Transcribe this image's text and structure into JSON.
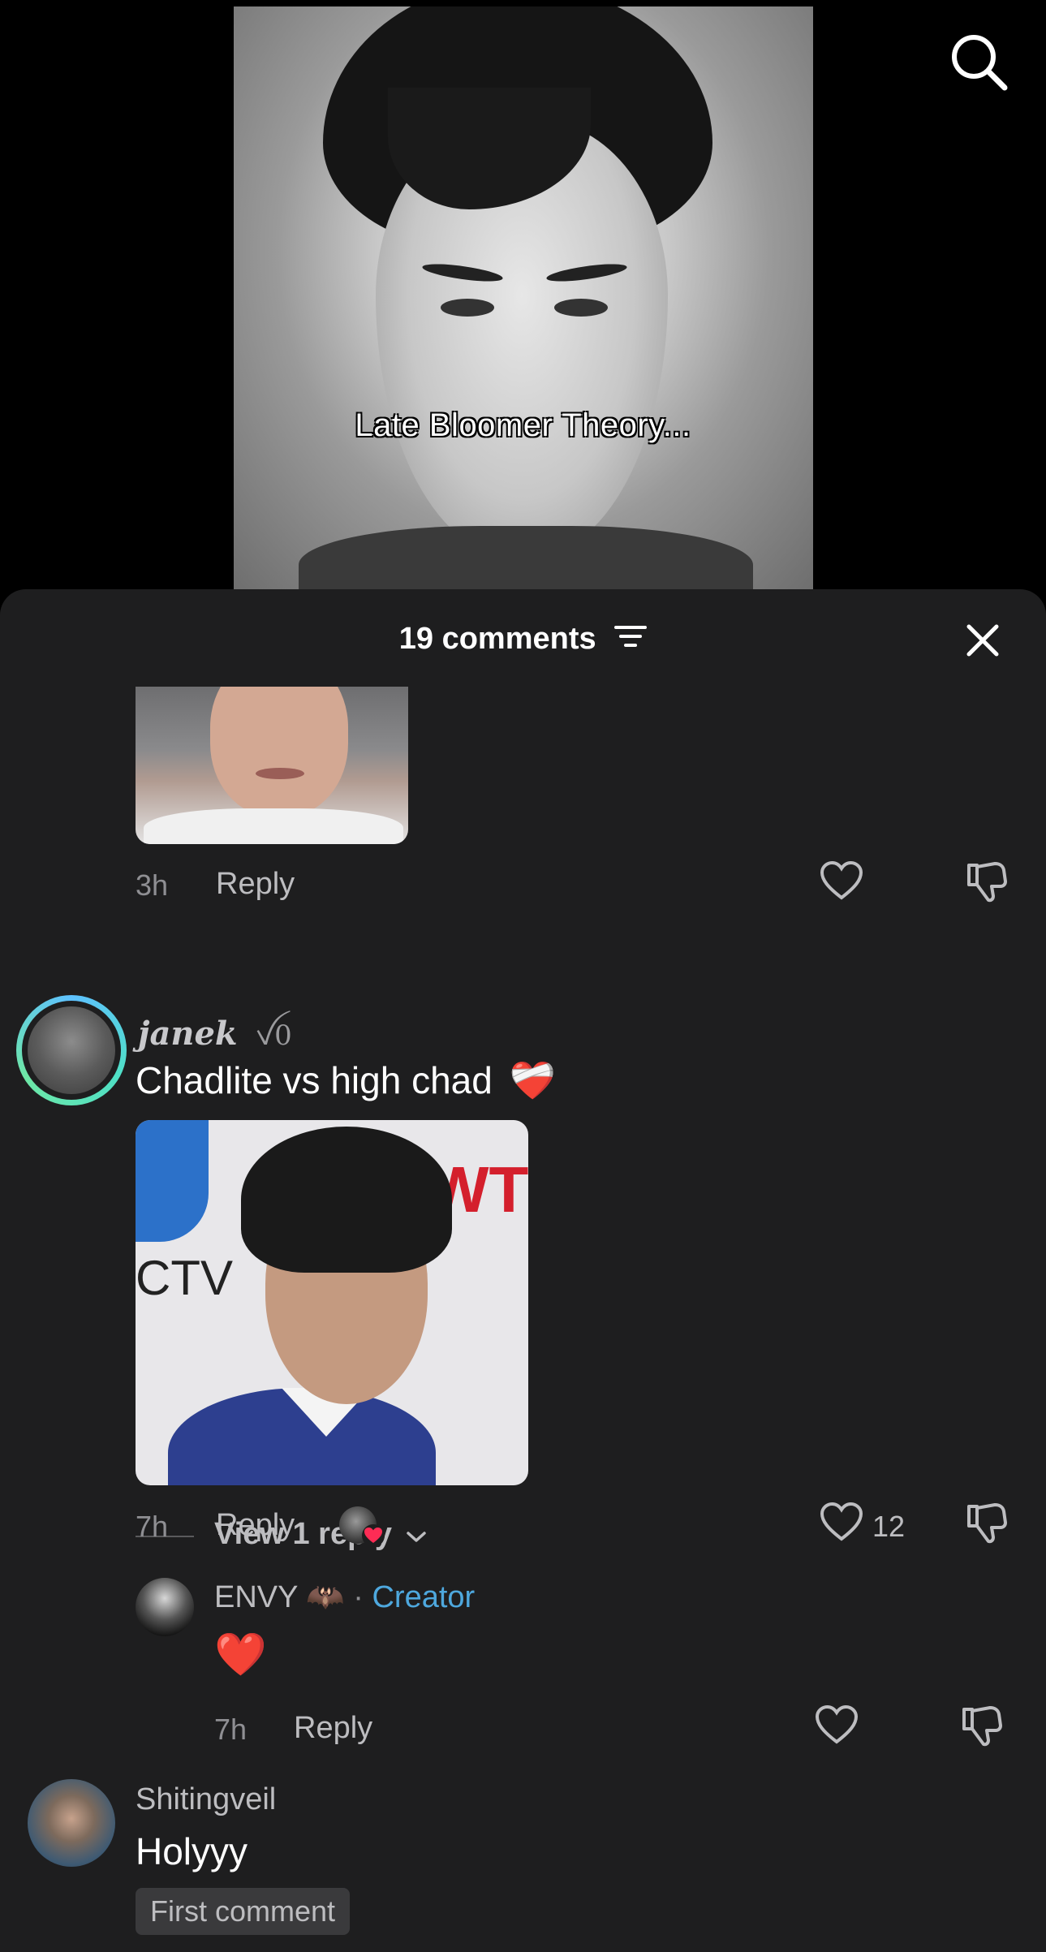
{
  "video": {
    "caption": "Late Bloomer Theory..."
  },
  "sheet": {
    "comments_count_label": "19 comments",
    "icons": {
      "filter": "filter-icon",
      "close": "close-icon",
      "search": "search-icon"
    }
  },
  "comments": [
    {
      "time": "3h",
      "reply_label": "Reply",
      "view_replies_label": "View 1 reply"
    },
    {
      "username": "janek",
      "user_badge": "ꪜ0",
      "text": "Chadlite vs high chad",
      "emoji": "❤️‍🩹",
      "image_text_left": "CTV",
      "image_text_right": "WTI",
      "time": "7h",
      "reply_label": "Reply",
      "like_count": "12",
      "reply": {
        "username": "ENVY",
        "username_emoji": "🦇",
        "separator": "·",
        "creator_label": "Creator",
        "text": "❤️",
        "time": "7h",
        "reply_label": "Reply"
      }
    },
    {
      "username": "Shitingveil",
      "text": "Holyyy",
      "tag": "First comment"
    }
  ],
  "colors": {
    "background": "#000000",
    "sheet": "#1e1e1f",
    "muted_text": "#8f8f93",
    "creator": "#4ea8de",
    "like_heart": "#fe2c55"
  }
}
